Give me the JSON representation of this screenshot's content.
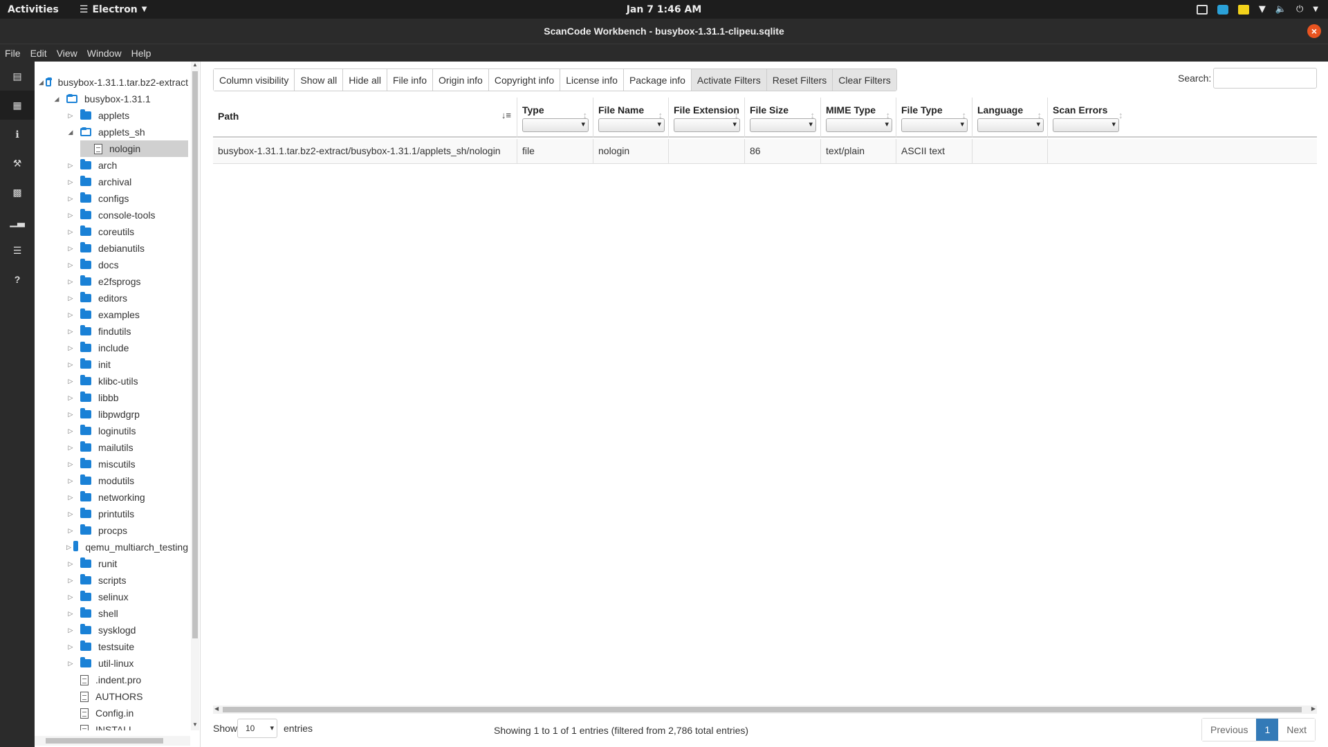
{
  "topbar": {
    "activities": "Activities",
    "app_name": "Electron",
    "clock": "Jan 7  1:46 AM"
  },
  "window": {
    "title": "ScanCode Workbench - busybox-1.31.1-clipeu.sqlite"
  },
  "menu": [
    "File",
    "Edit",
    "View",
    "Window",
    "Help"
  ],
  "sidebar_icons": [
    "directory-icon",
    "table-icon",
    "info-icon",
    "hammer-icon",
    "archive-icon",
    "bar-chart-icon",
    "list-icon",
    "question-icon"
  ],
  "tree": {
    "root": "busybox-1.31.1.tar.bz2-extract",
    "child": "busybox-1.31.1",
    "items": [
      {
        "label": "applets",
        "type": "folder",
        "level": 2,
        "expanded": false
      },
      {
        "label": "applets_sh",
        "type": "folder",
        "level": 2,
        "expanded": true
      },
      {
        "label": "nologin",
        "type": "file",
        "level": 3,
        "selected": true
      },
      {
        "label": "arch",
        "type": "folder",
        "level": 2
      },
      {
        "label": "archival",
        "type": "folder",
        "level": 2
      },
      {
        "label": "configs",
        "type": "folder",
        "level": 2
      },
      {
        "label": "console-tools",
        "type": "folder",
        "level": 2
      },
      {
        "label": "coreutils",
        "type": "folder",
        "level": 2
      },
      {
        "label": "debianutils",
        "type": "folder",
        "level": 2
      },
      {
        "label": "docs",
        "type": "folder",
        "level": 2
      },
      {
        "label": "e2fsprogs",
        "type": "folder",
        "level": 2
      },
      {
        "label": "editors",
        "type": "folder",
        "level": 2
      },
      {
        "label": "examples",
        "type": "folder",
        "level": 2
      },
      {
        "label": "findutils",
        "type": "folder",
        "level": 2
      },
      {
        "label": "include",
        "type": "folder",
        "level": 2
      },
      {
        "label": "init",
        "type": "folder",
        "level": 2
      },
      {
        "label": "klibc-utils",
        "type": "folder",
        "level": 2
      },
      {
        "label": "libbb",
        "type": "folder",
        "level": 2
      },
      {
        "label": "libpwdgrp",
        "type": "folder",
        "level": 2
      },
      {
        "label": "loginutils",
        "type": "folder",
        "level": 2
      },
      {
        "label": "mailutils",
        "type": "folder",
        "level": 2
      },
      {
        "label": "miscutils",
        "type": "folder",
        "level": 2
      },
      {
        "label": "modutils",
        "type": "folder",
        "level": 2
      },
      {
        "label": "networking",
        "type": "folder",
        "level": 2
      },
      {
        "label": "printutils",
        "type": "folder",
        "level": 2
      },
      {
        "label": "procps",
        "type": "folder",
        "level": 2
      },
      {
        "label": "qemu_multiarch_testing",
        "type": "folder",
        "level": 2
      },
      {
        "label": "runit",
        "type": "folder",
        "level": 2
      },
      {
        "label": "scripts",
        "type": "folder",
        "level": 2
      },
      {
        "label": "selinux",
        "type": "folder",
        "level": 2
      },
      {
        "label": "shell",
        "type": "folder",
        "level": 2
      },
      {
        "label": "sysklogd",
        "type": "folder",
        "level": 2
      },
      {
        "label": "testsuite",
        "type": "folder",
        "level": 2
      },
      {
        "label": "util-linux",
        "type": "folder",
        "level": 2
      },
      {
        "label": ".indent.pro",
        "type": "file",
        "level": 2
      },
      {
        "label": "AUTHORS",
        "type": "file",
        "level": 2
      },
      {
        "label": "Config.in",
        "type": "file",
        "level": 2
      },
      {
        "label": "INSTALL",
        "type": "file",
        "level": 2
      }
    ]
  },
  "toolbar": {
    "buttons": [
      "Column visibility",
      "Show all",
      "Hide all",
      "File info",
      "Origin info",
      "Copyright info",
      "License info",
      "Package info",
      "Activate Filters",
      "Reset Filters",
      "Clear Filters"
    ]
  },
  "search": {
    "label": "Search:",
    "value": ""
  },
  "table": {
    "columns": [
      "Path",
      "Type",
      "File Name",
      "File Extension",
      "File Size",
      "MIME Type",
      "File Type",
      "Language",
      "Scan Errors"
    ],
    "rows": [
      [
        "busybox-1.31.1.tar.bz2-extract/busybox-1.31.1/applets_sh/nologin",
        "file",
        "nologin",
        "",
        "86",
        "text/plain",
        "ASCII text",
        "",
        ""
      ]
    ]
  },
  "footer": {
    "show": "Show",
    "page_length": "10",
    "entries": "entries",
    "info": "Showing 1 to 1 of 1 entries (filtered from 2,786 total entries)",
    "previous": "Previous",
    "page": "1",
    "next": "Next"
  },
  "colors": {
    "accent": "#337ab7",
    "folder": "#1a81d6",
    "close": "#e95420"
  }
}
